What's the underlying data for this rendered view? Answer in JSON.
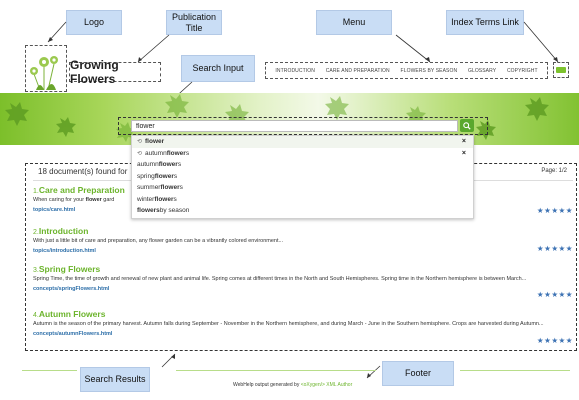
{
  "callouts": {
    "logo": "Logo",
    "publication_title": "Publication Title",
    "menu": "Menu",
    "index_terms_link": "Index Terms Link",
    "search_input": "Search Input",
    "search_results": "Search Results",
    "footer": "Footer"
  },
  "header": {
    "title": "Growing Flowers",
    "menu": [
      "INTRODUCTION",
      "CARE AND PREPARATION",
      "FLOWERS BY SEASON",
      "GLOSSARY",
      "COPYRIGHT"
    ]
  },
  "search": {
    "value": "flower",
    "suggestions": [
      {
        "pre": "",
        "bold": "flower",
        "post": "",
        "history": true
      },
      {
        "pre": "autumn ",
        "bold": "flower",
        "post": "s",
        "history": true
      },
      {
        "pre": "autumn ",
        "bold": "flower",
        "post": "s",
        "history": false
      },
      {
        "pre": "spring ",
        "bold": "flower",
        "post": "s",
        "history": false
      },
      {
        "pre": "summer ",
        "bold": "flower",
        "post": "s",
        "history": false
      },
      {
        "pre": "winter ",
        "bold": "flower",
        "post": "s",
        "history": false
      },
      {
        "pre": "",
        "bold": "flowers",
        "post": " by season",
        "history": false
      }
    ]
  },
  "results": {
    "found_text": "18 document(s) found for",
    "page": "Page: 1/2",
    "items": [
      {
        "num": "1.",
        "title": "Care and Preparation",
        "snippet_pre": "When caring for your ",
        "snippet_bold": "flower",
        "snippet_post": " gard",
        "link": "topics/care.html",
        "stars": "★★★★★"
      },
      {
        "num": "2.",
        "title": "Introduction",
        "snippet": "With just a little bit of care and preparation, any flower garden can be a vibrantly colored environment...",
        "link": "topics/introduction.html",
        "stars": "★★★★★"
      },
      {
        "num": "3.",
        "title": "Spring Flowers",
        "snippet": "Spring Time, the time of growth and renewal of new plant and animal life. Spring comes at different times in the North and South Hemispheres. Spring time in the Northern hemisphere is between March...",
        "link": "concepts/springFlowers.html",
        "stars": "★★★★★"
      },
      {
        "num": "4.",
        "title": "Autumn Flowers",
        "snippet": "Autumn is the season of the primary harvest. Autumn falls during September - November in the Northern hemisphere, and during March - June in the Southern hemisphere. Crops are harvested during Autumn...",
        "link": "concepts/autumnFlowers.html",
        "stars": "★★★★★"
      }
    ]
  },
  "footer": {
    "prefix": "WebHelp output generated by ",
    "brand": "<oXygen/> XML Author"
  }
}
